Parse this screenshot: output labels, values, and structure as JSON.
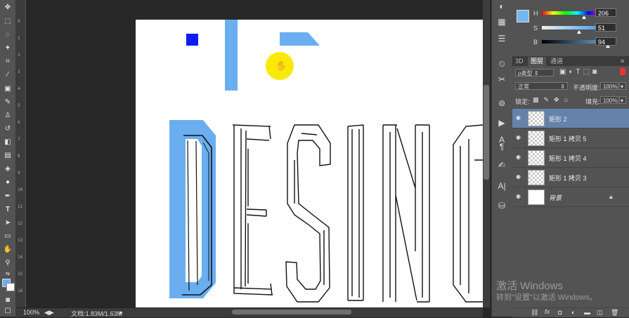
{
  "status": {
    "zoom": "100%",
    "doc_info": "文档:1.83M/1.63M"
  },
  "vruler_ticks": [
    "0",
    "1",
    "2",
    "3",
    "4",
    "5",
    "6",
    "7",
    "8",
    "9",
    "10",
    "11",
    "12",
    "13",
    "14",
    "15",
    "16"
  ],
  "color_panel": {
    "h_label": "H",
    "h_value": "206",
    "h_pct": 0.57,
    "s_label": "S",
    "s_value": "51",
    "s_pct": 0.51,
    "b_label": "B",
    "b_value": "94",
    "b_pct": 0.94,
    "swatch_color": "#76b6f0"
  },
  "panel_tabs": [
    "3D",
    "图层",
    "通道"
  ],
  "layer_controls": {
    "filter_label": "ρ类型",
    "blend_mode": "正常",
    "opacity_label": "不透明度:",
    "opacity_value": "100%",
    "lock_label": "锁定:",
    "fill_label": "填充:",
    "fill_value": "100%"
  },
  "layers": [
    {
      "name": "矩形 2",
      "selected": true
    },
    {
      "name": "矩形 1 拷贝 5",
      "selected": false
    },
    {
      "name": "矩形 1 拷贝 4",
      "selected": false
    },
    {
      "name": "矩形 1 拷贝 3",
      "selected": false
    },
    {
      "name": "背景",
      "selected": false,
      "locked": true
    }
  ],
  "layer_footer_icons": [
    "link-icon",
    "fx-icon",
    "mask-icon",
    "adjustment-icon",
    "folder-icon",
    "new-layer-icon",
    "trash-icon"
  ],
  "watermark": {
    "line1": "激活 Windows",
    "line2": "转到\"设置\"以激活 Windows。"
  },
  "accent_colors": {
    "light_blue": "#6aaef0",
    "blue": "#0b1df0",
    "yellow": "#f9ea05",
    "selection": "#6582aa"
  },
  "canvas_text": "DESING"
}
